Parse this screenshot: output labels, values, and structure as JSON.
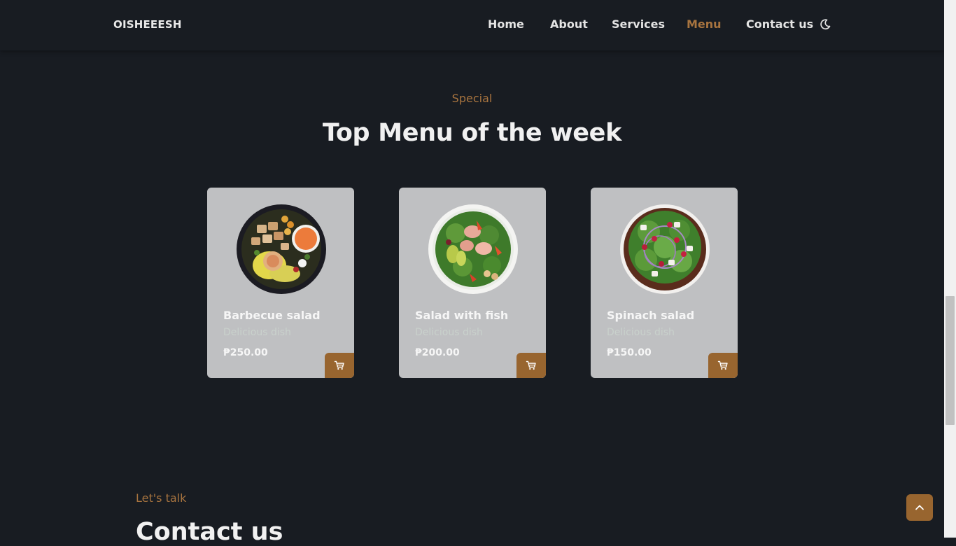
{
  "header": {
    "logo": "OISHEEESH",
    "nav": [
      {
        "label": "Home"
      },
      {
        "label": "About"
      },
      {
        "label": "Services"
      },
      {
        "label": "Menu",
        "active": true
      },
      {
        "label": "Contact us"
      }
    ],
    "theme_icon": "moon-icon"
  },
  "menu_section": {
    "subtitle": "Special",
    "title": "Top Menu of the week",
    "items": [
      {
        "name": "Barbecue salad",
        "description": "Delicious dish",
        "price": "₱250.00",
        "image": "barbecue-salad-bowl"
      },
      {
        "name": "Salad with fish",
        "description": "Delicious dish",
        "price": "₱200.00",
        "image": "fish-salad-bowl"
      },
      {
        "name": "Spinach salad",
        "description": "Delicious dish",
        "price": "₱150.00",
        "image": "spinach-salad-bowl"
      }
    ],
    "cart_icon": "cart-icon"
  },
  "contact_section": {
    "subtitle": "Let's talk",
    "title": "Contact us"
  },
  "scrollup_icon": "chevron-up-icon",
  "colors": {
    "background": "#181c22",
    "accent": "#a8743f",
    "card": "#bfc0c2",
    "button": "#98652f"
  }
}
